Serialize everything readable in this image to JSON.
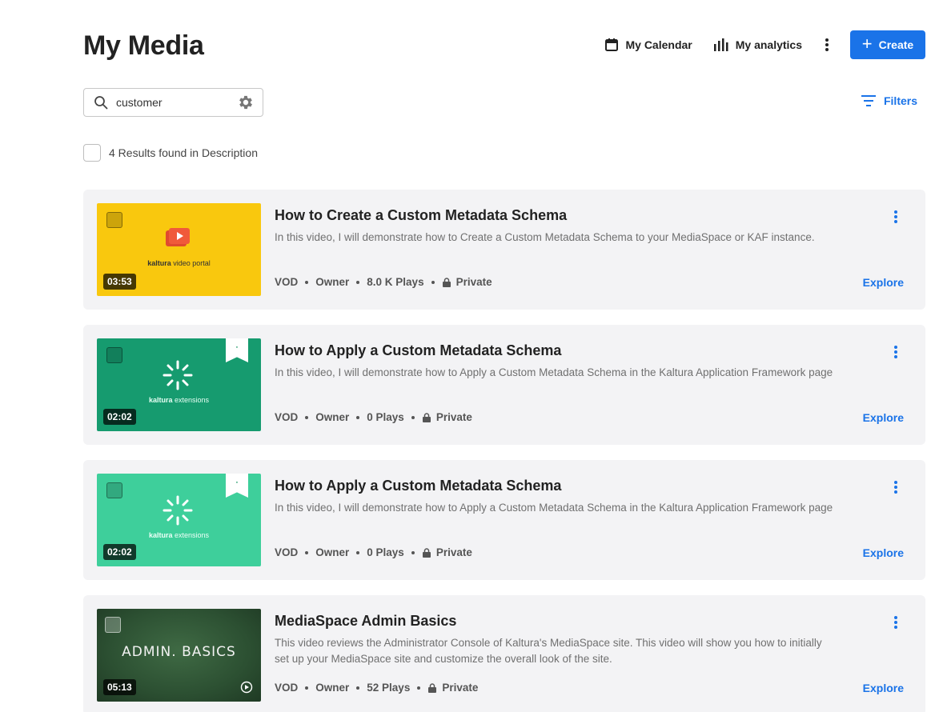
{
  "header": {
    "title": "My Media",
    "calendar_label": "My Calendar",
    "analytics_label": "My analytics",
    "create_label": "Create"
  },
  "search": {
    "value": "customer",
    "placeholder": "Search"
  },
  "filters_label": "Filters",
  "results_text": "4 Results found in Description",
  "colors": {
    "accent": "#1a73e8",
    "card_bg": "#f3f3f5"
  },
  "media": [
    {
      "title": "How to Create a Custom Metadata Schema",
      "description": "In this video, I will demonstrate how to Create a Custom Metadata Schema to your MediaSpace or KAF instance.",
      "duration": "03:53",
      "type": "VOD",
      "role": "Owner",
      "plays": "8.0 K Plays",
      "privacy": "Private",
      "action": "Explore",
      "thumb_brand_bold": "kaltura",
      "thumb_brand_rest": " video portal"
    },
    {
      "title": "How to Apply a Custom Metadata Schema",
      "description": "In this video, I will demonstrate how to Apply a Custom Metadata Schema in the Kaltura Application Framework page",
      "duration": "02:02",
      "type": "VOD",
      "role": "Owner",
      "plays": "0 Plays",
      "privacy": "Private",
      "action": "Explore",
      "thumb_brand_bold": "kaltura",
      "thumb_brand_rest": " extensions"
    },
    {
      "title": "How to Apply a Custom Metadata Schema",
      "description": "In this video, I will demonstrate how to Apply a Custom Metadata Schema in the Kaltura Application Framework page",
      "duration": "02:02",
      "type": "VOD",
      "role": "Owner",
      "plays": "0 Plays",
      "privacy": "Private",
      "action": "Explore",
      "thumb_brand_bold": "kaltura",
      "thumb_brand_rest": " extensions"
    },
    {
      "title": "MediaSpace Admin Basics",
      "description": "This video reviews the Administrator Console of Kaltura's MediaSpace site. This video will show you how to initially set up your MediaSpace site and customize the overall look of the site.",
      "duration": "05:13",
      "type": "VOD",
      "role": "Owner",
      "plays": "52 Plays",
      "privacy": "Private",
      "action": "Explore",
      "thumb_text": "ADMIN. BASICS"
    }
  ]
}
